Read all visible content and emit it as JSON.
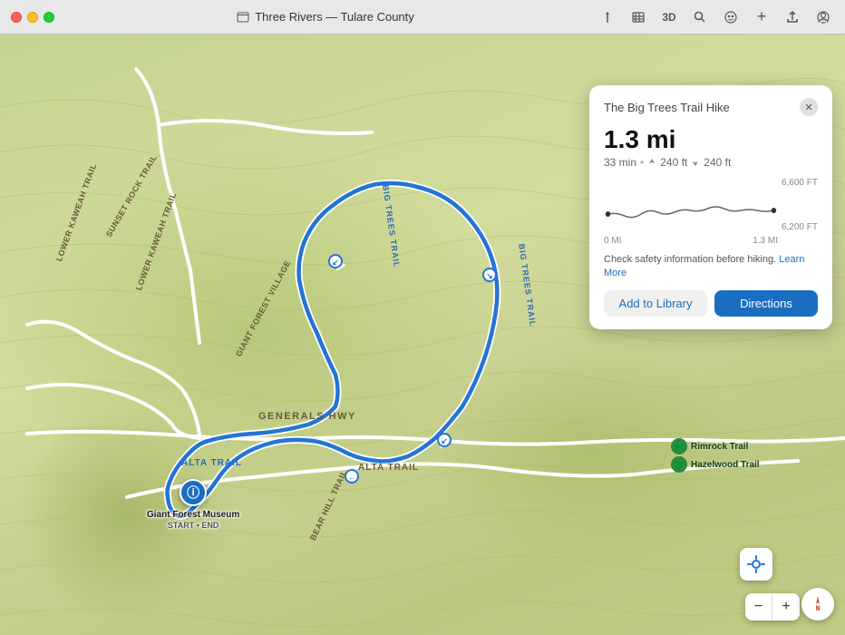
{
  "titlebar": {
    "title": "Three Rivers — Tulare County",
    "icon": "map-icon"
  },
  "toolbar": {
    "directions_icon": "⤷",
    "map_icon": "⊞",
    "threed_label": "3D",
    "binoculars_icon": "🔭",
    "smiley_icon": "☺",
    "plus_icon": "+",
    "share_icon": "↑",
    "account_icon": "◉"
  },
  "panel": {
    "title": "The Big Trees Trail Hike",
    "distance": "1.3 mi",
    "time": "33 min",
    "elevation_up": "240 ft",
    "elevation_down": "240 ft",
    "elevation_high_label": "6,600 FT",
    "elevation_low_label": "6,200 FT",
    "distance_start": "0 MI",
    "distance_end": "1.3 MI",
    "safety_text": "Check safety information before hiking.",
    "learn_more": "Learn More",
    "add_library": "Add to Library",
    "directions": "Directions"
  },
  "map": {
    "trail_label_1": "BIG TREES TRAIL",
    "trail_label_2": "BIG TREES TRAIL",
    "road_generals": "GENERALS HWY",
    "road_alta": "ALTA TRAIL",
    "road_sunset": "SUNSET ROCK TRAIL",
    "road_lower": "LOWER KAWEAH TRAIL",
    "road_lower2": "LOWER KAWEAH TRAIL",
    "road_giant": "GIANT FOREST VILLAGE",
    "road_bear": "BEAR HILL TRAIL",
    "poi_name": "Giant Forest Museum",
    "poi_sub": "START • END",
    "poi_rimrock": "Rimrock Trail",
    "poi_hazelwood": "Hazelwood Trail"
  },
  "controls": {
    "zoom_minus": "−",
    "zoom_plus": "+",
    "compass_label": "N",
    "gps_icon": "≋"
  }
}
